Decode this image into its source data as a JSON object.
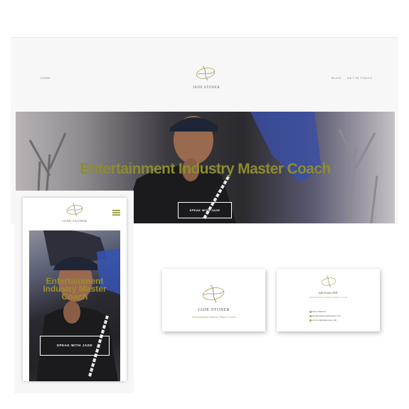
{
  "desktop": {
    "nav_left": "HOME",
    "nav_right": [
      "BLOG",
      "GET IN TOUCH"
    ],
    "brand": "JADE STONER",
    "hero_title": "Entertainment Industry Master Coach",
    "hero_button": "SPEAK WITH JADE"
  },
  "mobile": {
    "brand": "JADE STONER",
    "hero_title": "Entertainment Industry Master Coach",
    "hero_button": "SPEAK WITH JADE",
    "menu_icon": "hamburger-icon"
  },
  "card_front": {
    "name": "JADE STONER",
    "subtitle": "Entertainment Industry Master Coach"
  },
  "card_back": {
    "name": "Jade Stoner AMC",
    "subtitle": "Entertainment Industry Master Coach",
    "phone": "07424 408213",
    "email": "jade@jadejstonermaster.com",
    "web": "www.jadejadestoner.com"
  },
  "colors": {
    "accent_gold": "#8d8c2e",
    "logo_gold": "#b5a64a"
  }
}
